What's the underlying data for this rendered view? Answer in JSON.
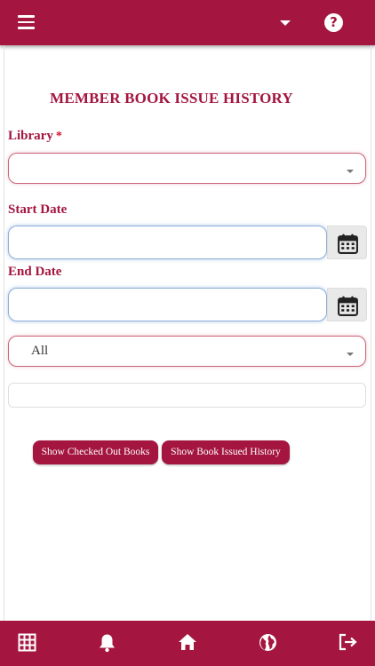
{
  "header": {
    "menu_icon": "hamburger-menu-icon",
    "dropdown_icon": "caret-down-icon",
    "help_icon": "help-icon",
    "help_glyph": "?"
  },
  "page": {
    "title": "MEMBER BOOK ISSUE HISTORY"
  },
  "form": {
    "library_label": "Library",
    "required_mark": "*",
    "library_value": "",
    "start_date_label": "Start Date",
    "start_date_value": "",
    "end_date_label": "End Date",
    "end_date_value": "",
    "filter_value": "All",
    "calendar_icon": "calendar-icon"
  },
  "actions": {
    "checked_out_label": "Show Checked Out Books",
    "issued_history_label": "Show Book Issued History"
  },
  "bottom_nav": {
    "items": [
      "grid-icon",
      "bell-icon",
      "home-icon",
      "globe-icon",
      "logout-icon"
    ]
  },
  "colors": {
    "brand": "#a4153f",
    "required": "#d0112b",
    "date_border": "#8aaed8"
  }
}
